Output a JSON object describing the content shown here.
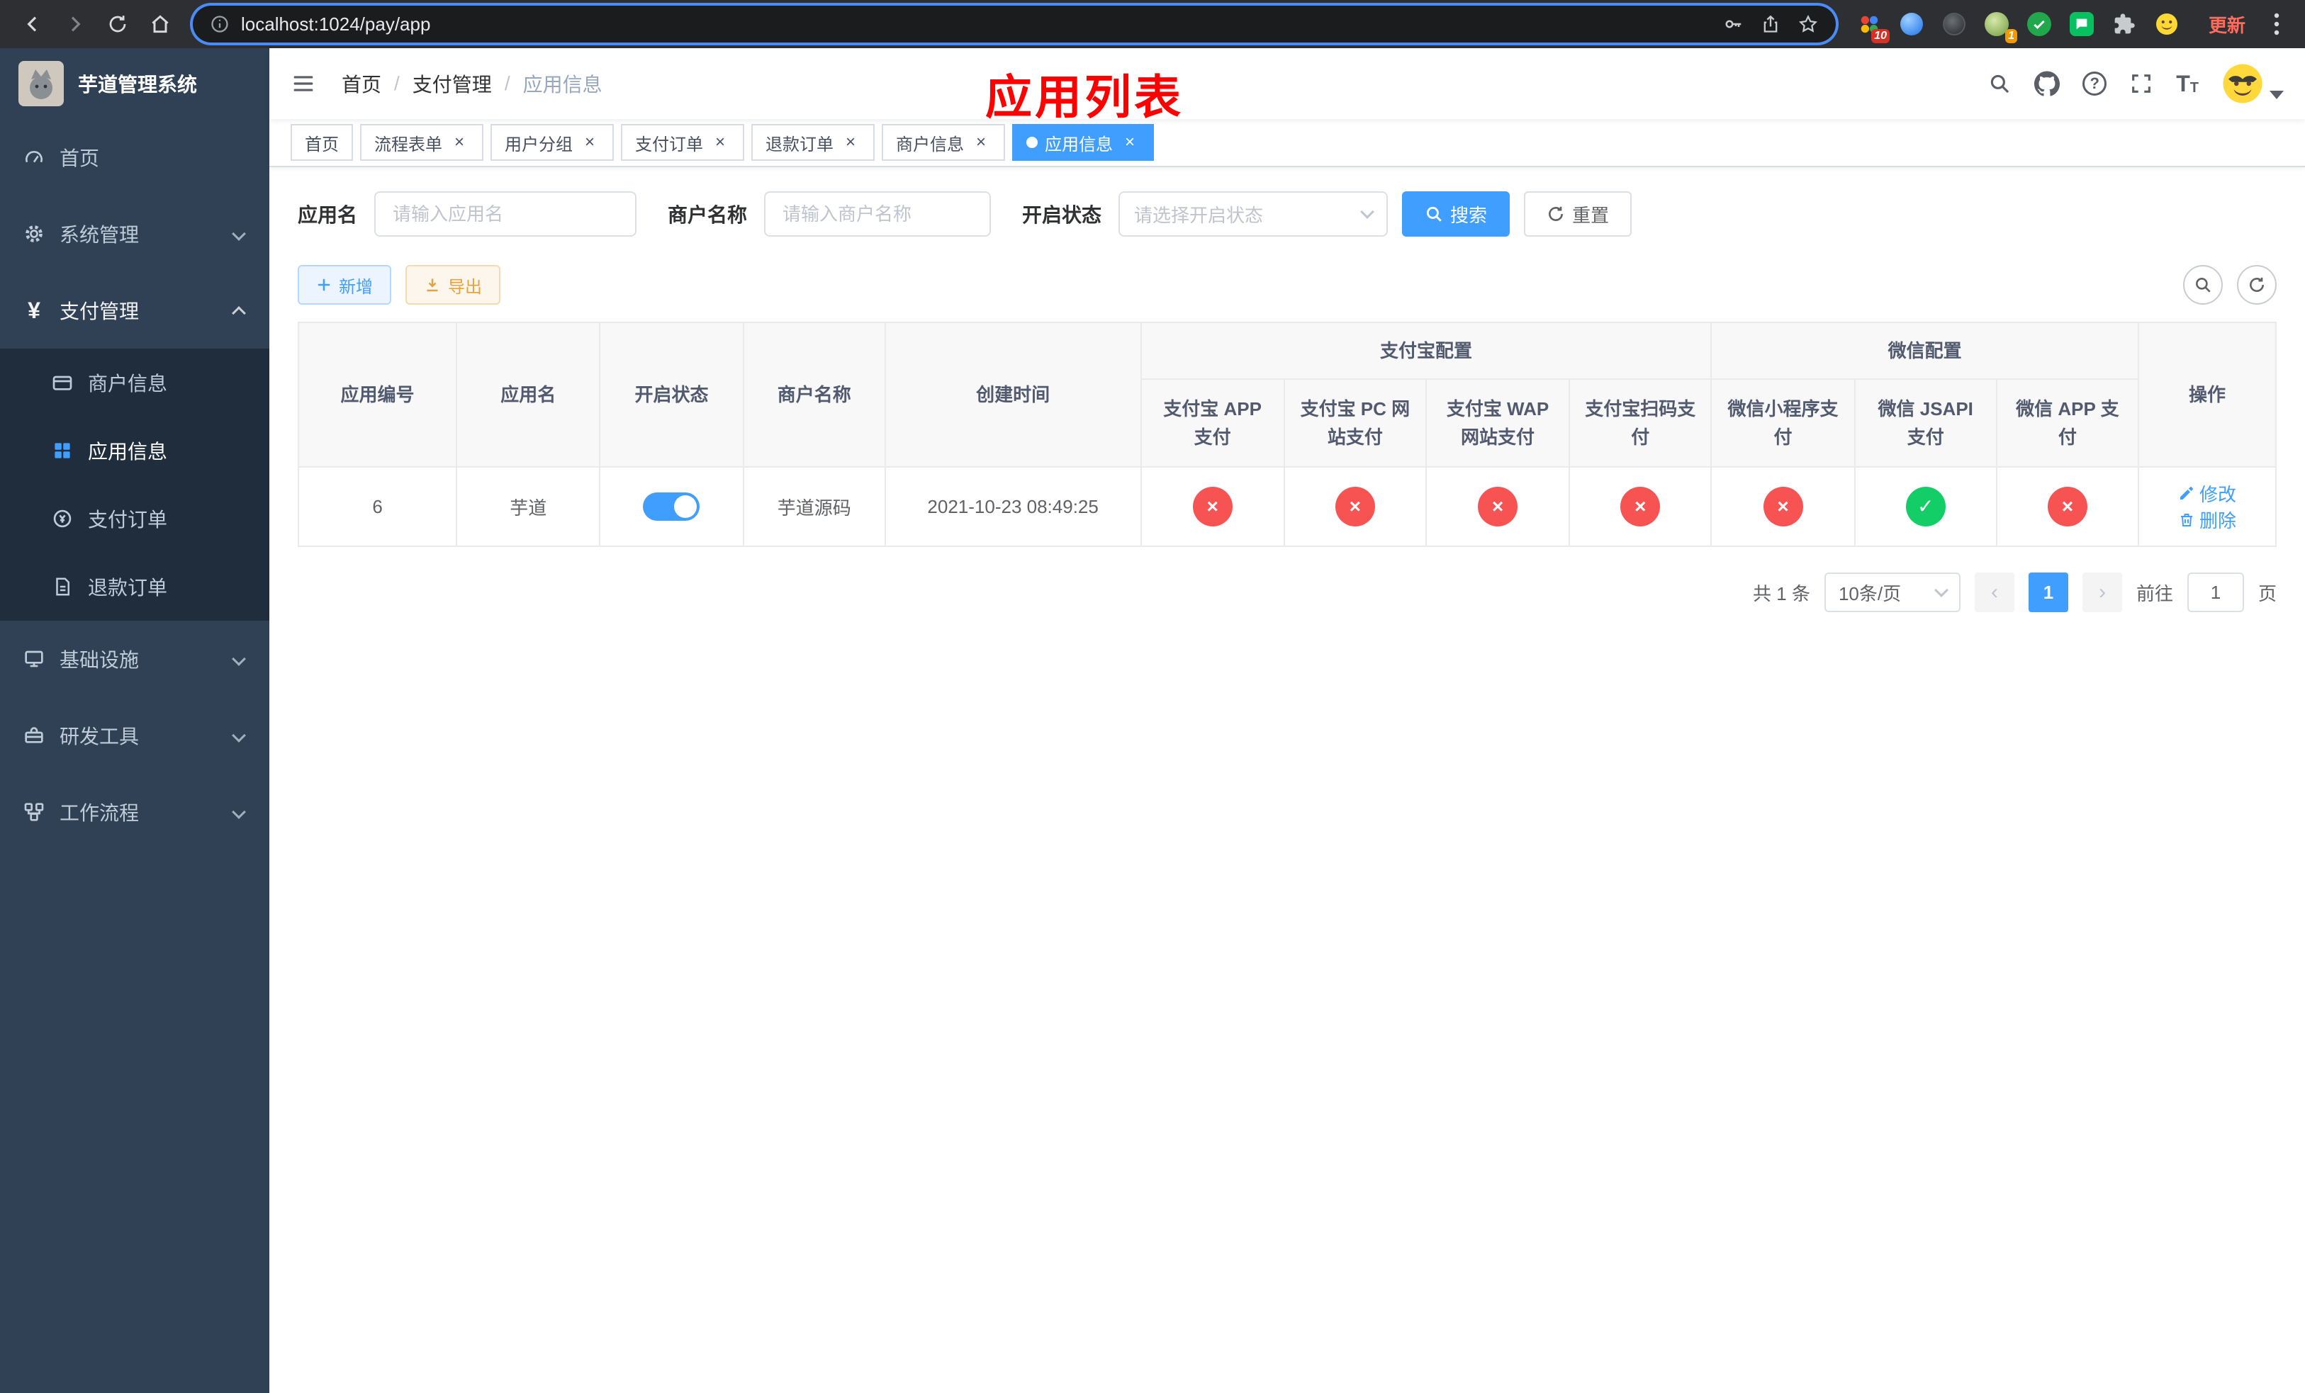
{
  "browser": {
    "url": "localhost:1024/pay/app",
    "update_label": "更新",
    "grid_badge": "10",
    "avatar_badge": "1"
  },
  "sidebar": {
    "title": "芋道管理系统",
    "items": [
      {
        "label": "首页"
      },
      {
        "label": "系统管理"
      },
      {
        "label": "支付管理"
      },
      {
        "label": "基础设施"
      },
      {
        "label": "研发工具"
      },
      {
        "label": "工作流程"
      }
    ],
    "pay_children": [
      {
        "label": "商户信息"
      },
      {
        "label": "应用信息"
      },
      {
        "label": "支付订单"
      },
      {
        "label": "退款订单"
      }
    ]
  },
  "header": {
    "breadcrumb": [
      "首页",
      "支付管理",
      "应用信息"
    ],
    "separator": "/",
    "annotation": "应用列表",
    "help_glyph": "?",
    "font_glyph_big": "T",
    "font_glyph_small": "T"
  },
  "tabs": {
    "close_glyph": "×",
    "items": [
      {
        "label": "首页"
      },
      {
        "label": "流程表单"
      },
      {
        "label": "用户分组"
      },
      {
        "label": "支付订单"
      },
      {
        "label": "退款订单"
      },
      {
        "label": "商户信息"
      },
      {
        "label": "应用信息"
      }
    ]
  },
  "filters": {
    "app_name_label": "应用名",
    "app_name_placeholder": "请输入应用名",
    "merchant_label": "商户名称",
    "merchant_placeholder": "请输入商户名称",
    "status_label": "开启状态",
    "status_placeholder": "请选择开启状态",
    "search_label": "搜索",
    "reset_label": "重置"
  },
  "toolbar": {
    "add_label": "新增",
    "export_label": "导出"
  },
  "table": {
    "group_alipay": "支付宝配置",
    "group_wechat": "微信配置",
    "col_headers": {
      "app_id": "应用编号",
      "app_name": "应用名",
      "status": "开启状态",
      "merchant": "商户名称",
      "created": "创建时间",
      "alipay_app": "支付宝 APP 支付",
      "alipay_pc": "支付宝 PC 网站支付",
      "alipay_wap": "支付宝 WAP 网站支付",
      "alipay_qr": "支付宝扫码支付",
      "wx_lite": "微信小程序支付",
      "wx_jsapi": "微信 JSAPI 支付",
      "wx_app": "微信 APP 支付",
      "actions": "操作"
    },
    "glyph_no": "×",
    "glyph_yes": "✓",
    "rows": [
      {
        "app_id": "6",
        "app_name": "芋道",
        "status_on": true,
        "merchant": "芋道源码",
        "created": "2021-10-23 08:49:25",
        "alipay_app": "no",
        "alipay_pc": "no",
        "alipay_wap": "no",
        "alipay_qr": "no",
        "wx_lite": "no",
        "wx_jsapi": "yes",
        "wx_app": "no",
        "edit_label": "修改",
        "delete_label": "删除"
      }
    ]
  },
  "pagination": {
    "total": "共 1 条",
    "page_size": "10条/页",
    "prev_glyph": "‹",
    "next_glyph": "›",
    "page": "1",
    "goto_label": "前往",
    "goto_value": "1",
    "page_unit": "页"
  },
  "colors": {
    "primary": "#409eff",
    "success": "#13ce66",
    "danger": "#f75353",
    "warning": "#e6a23c",
    "sidebar_bg": "#304156",
    "submenu_bg": "#1f2d3d",
    "annotation": "#ff0000"
  }
}
